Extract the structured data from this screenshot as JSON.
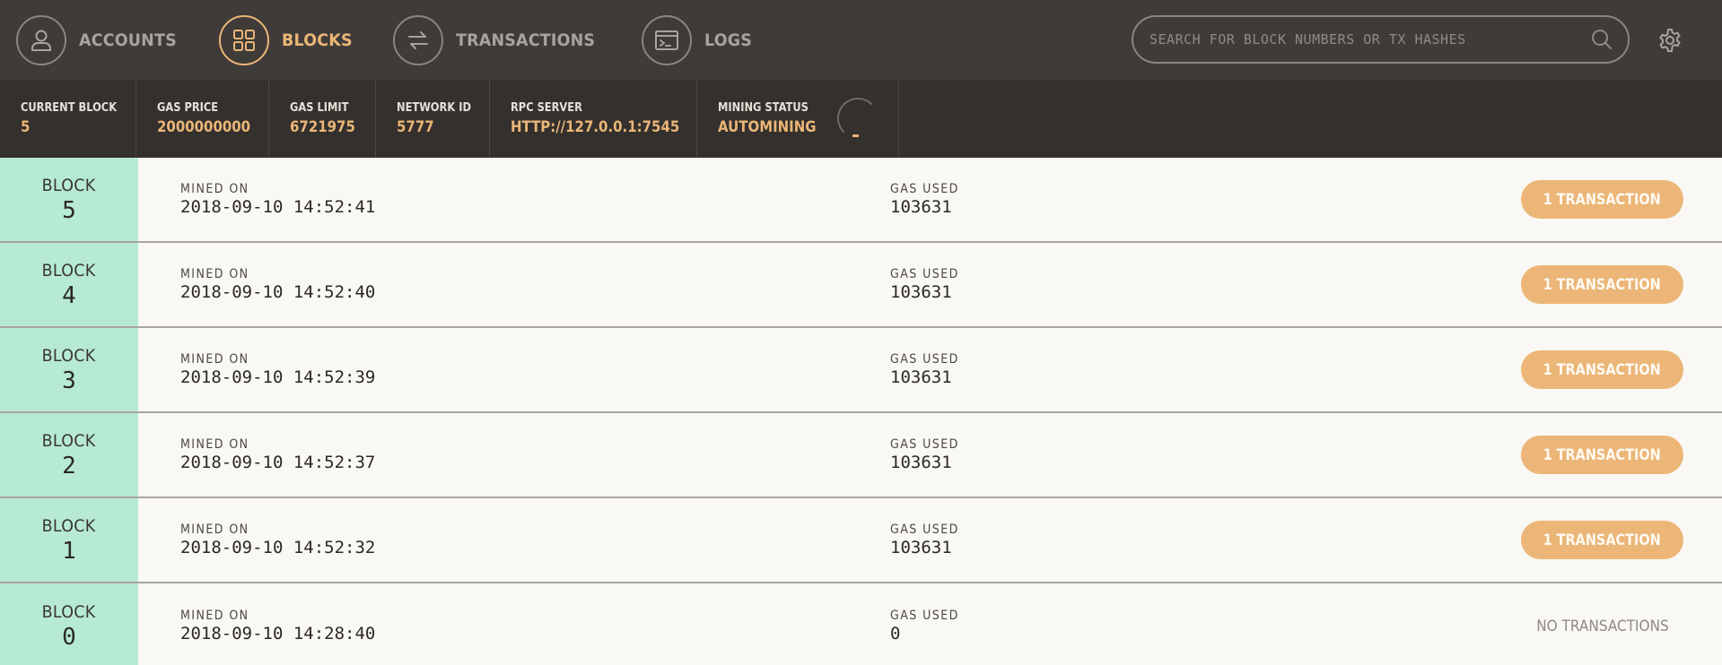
{
  "nav": {
    "items": [
      {
        "key": "accounts",
        "label": "ACCOUNTS",
        "icon": "user-icon",
        "active": false
      },
      {
        "key": "blocks",
        "label": "BLOCKS",
        "icon": "grid-icon",
        "active": true
      },
      {
        "key": "transactions",
        "label": "TRANSACTIONS",
        "icon": "arrows-icon",
        "active": false
      },
      {
        "key": "logs",
        "label": "LOGS",
        "icon": "terminal-icon",
        "active": false
      }
    ],
    "search_placeholder": "SEARCH FOR BLOCK NUMBERS OR TX HASHES",
    "search_icon": "search-icon",
    "settings_icon": "gear-icon"
  },
  "status": {
    "current_block": {
      "label": "CURRENT BLOCK",
      "value": "5"
    },
    "gas_price": {
      "label": "GAS PRICE",
      "value": "2000000000"
    },
    "gas_limit": {
      "label": "GAS LIMIT",
      "value": "6721975"
    },
    "network_id": {
      "label": "NETWORK ID",
      "value": "5777"
    },
    "rpc_server": {
      "label": "RPC SERVER",
      "value": "HTTP://127.0.0.1:7545"
    },
    "mining_status": {
      "label": "MINING STATUS",
      "value": "AUTOMINING"
    }
  },
  "block_label": "BLOCK",
  "mined_on_label": "MINED ON",
  "gas_used_label": "GAS USED",
  "blocks": [
    {
      "number": "5",
      "mined_on": "2018-09-10 14:52:41",
      "gas_used": "103631",
      "tx_label": "1 TRANSACTION",
      "has_tx": true
    },
    {
      "number": "4",
      "mined_on": "2018-09-10 14:52:40",
      "gas_used": "103631",
      "tx_label": "1 TRANSACTION",
      "has_tx": true
    },
    {
      "number": "3",
      "mined_on": "2018-09-10 14:52:39",
      "gas_used": "103631",
      "tx_label": "1 TRANSACTION",
      "has_tx": true
    },
    {
      "number": "2",
      "mined_on": "2018-09-10 14:52:37",
      "gas_used": "103631",
      "tx_label": "1 TRANSACTION",
      "has_tx": true
    },
    {
      "number": "1",
      "mined_on": "2018-09-10 14:52:32",
      "gas_used": "103631",
      "tx_label": "1 TRANSACTION",
      "has_tx": true
    },
    {
      "number": "0",
      "mined_on": "2018-09-10 14:28:40",
      "gas_used": "0",
      "tx_label": "NO TRANSACTIONS",
      "has_tx": false
    }
  ],
  "colors": {
    "nav_bg": "#3f3b38",
    "status_bg": "#33302d",
    "accent": "#ebb677",
    "block_id_bg": "#b6ead4",
    "row_bg": "#faf8f4"
  }
}
